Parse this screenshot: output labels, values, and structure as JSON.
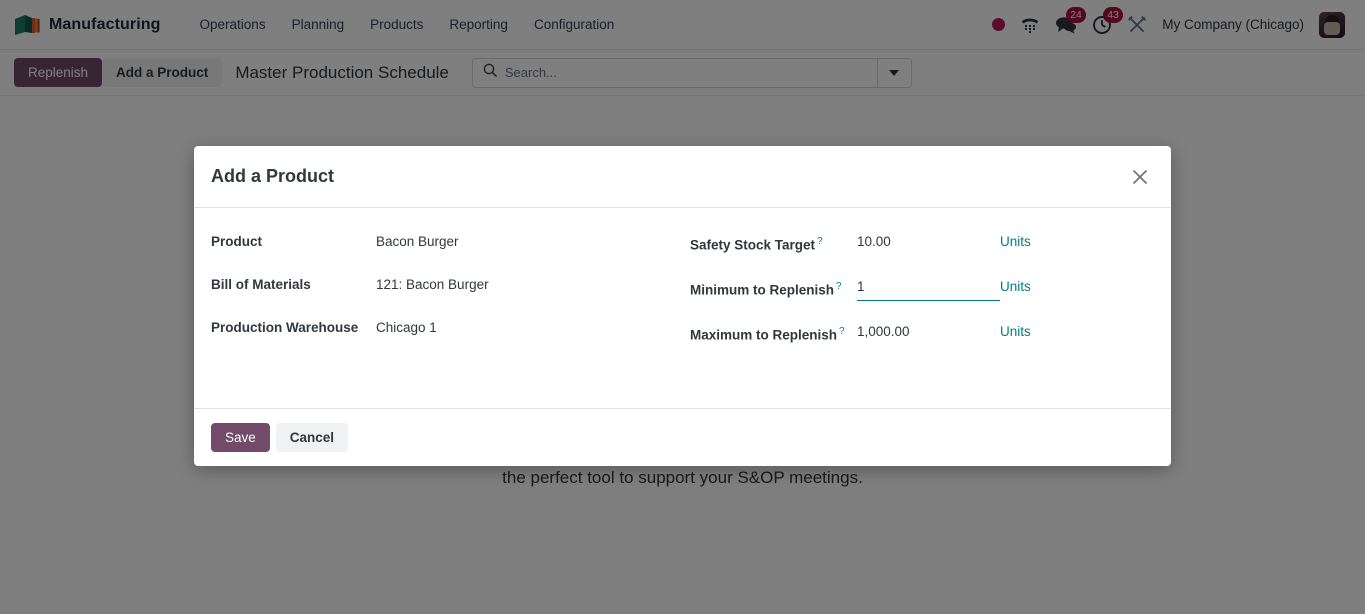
{
  "navbar": {
    "brand": "Manufacturing",
    "brand_logo_icon": "manufacturing-box-logo",
    "menu": [
      {
        "label": "Operations"
      },
      {
        "label": "Planning"
      },
      {
        "label": "Products"
      },
      {
        "label": "Reporting"
      },
      {
        "label": "Configuration"
      }
    ],
    "status_icons": [
      {
        "icon": "record-dot-icon",
        "badge": ""
      },
      {
        "icon": "phone-keypad-icon",
        "badge": ""
      },
      {
        "icon": "chat-bubble-icon",
        "badge": "24"
      },
      {
        "icon": "activity-clock-icon",
        "badge": "43"
      },
      {
        "icon": "crossed-tools-icon",
        "badge": ""
      }
    ],
    "company": "My Company (Chicago)",
    "avatar_icon": "user-avatar"
  },
  "controlbar": {
    "replenish_label": "Replenish",
    "add_product_label": "Add a Product",
    "page_title": "Master Production Schedule",
    "search": {
      "icon": "search-icon",
      "placeholder": "Search...",
      "value": "",
      "toggle_icon": "chevron-down-icon"
    }
  },
  "page": {
    "tagline": "the perfect tool to support your S&OP meetings."
  },
  "modal": {
    "title": "Add a Product",
    "close_icon": "close-icon",
    "left_fields": [
      {
        "label": "Product",
        "value": "Bacon Burger"
      },
      {
        "label": "Bill of Materials",
        "value": "121: Bacon Burger"
      },
      {
        "label": "Production Warehouse",
        "value": "Chicago 1"
      }
    ],
    "right_fields": [
      {
        "label": "Safety Stock Target",
        "help": "?",
        "value": "10.00",
        "unit": "Units",
        "focused": false
      },
      {
        "label": "Minimum to Replenish",
        "help": "?",
        "value": "1",
        "unit": "Units",
        "focused": true
      },
      {
        "label": "Maximum to Replenish",
        "help": "?",
        "value": "1,000.00",
        "unit": "Units",
        "focused": false
      }
    ],
    "save_label": "Save",
    "cancel_label": "Cancel"
  },
  "colors": {
    "primary": "#714b67",
    "accent_teal": "#017e84",
    "badge_red": "#a8103e",
    "record_red": "#b4185b"
  }
}
